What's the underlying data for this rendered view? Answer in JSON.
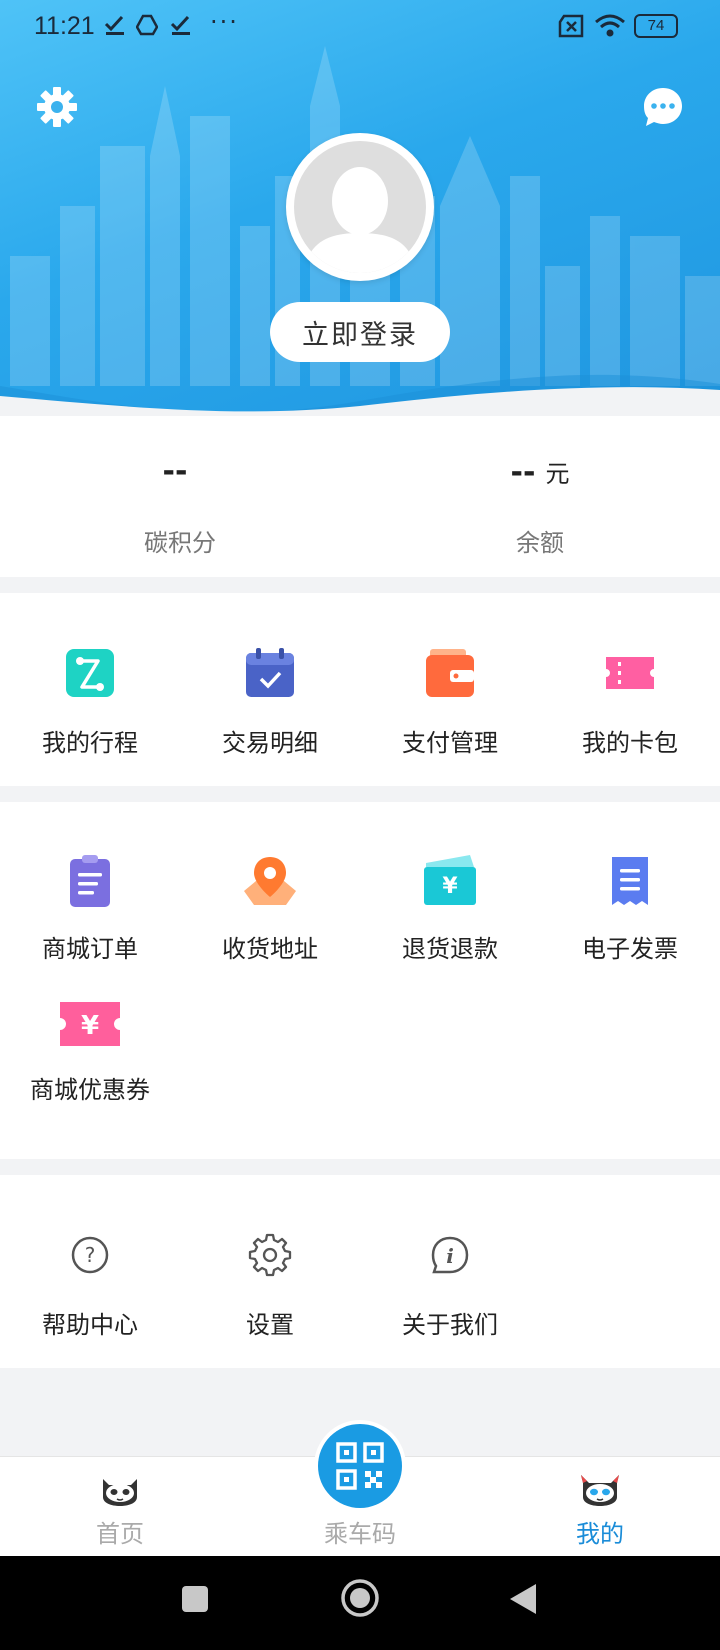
{
  "status_bar": {
    "time": "11:21",
    "overflow": "···",
    "battery": "74"
  },
  "header": {
    "login_label": "立即登录"
  },
  "stats": [
    {
      "value": "--",
      "unit": "",
      "label": "碳积分"
    },
    {
      "value": "--",
      "unit": "元",
      "label": "余额"
    }
  ],
  "section1": [
    {
      "label": "我的行程",
      "icon": "trip-icon",
      "color": "#1ed3c4"
    },
    {
      "label": "交易明细",
      "icon": "calendar-icon",
      "color": "#4a63c7"
    },
    {
      "label": "支付管理",
      "icon": "wallet-icon",
      "color": "#ff6a3d"
    },
    {
      "label": "我的卡包",
      "icon": "card-icon",
      "color": "#ff5fa2"
    }
  ],
  "section2": [
    {
      "label": "商城订单",
      "icon": "order-icon",
      "color": "#7b6fe0"
    },
    {
      "label": "收货地址",
      "icon": "location-icon",
      "color": "#ff8a3d"
    },
    {
      "label": "退货退款",
      "icon": "refund-icon",
      "color": "#1ac8d6"
    },
    {
      "label": "电子发票",
      "icon": "invoice-icon",
      "color": "#5b7cf0"
    },
    {
      "label": "商城优惠券",
      "icon": "coupon-icon",
      "color": "#ff5f9c"
    }
  ],
  "section3": [
    {
      "label": "帮助中心",
      "icon": "help-icon"
    },
    {
      "label": "设置",
      "icon": "settings-icon"
    },
    {
      "label": "关于我们",
      "icon": "info-icon"
    }
  ],
  "bottom_nav": [
    {
      "label": "首页",
      "icon": "home-mascot-icon",
      "active": false
    },
    {
      "label": "乘车码",
      "icon": "qr-code-icon",
      "active": false
    },
    {
      "label": "我的",
      "icon": "profile-mascot-icon",
      "active": true
    }
  ],
  "colors": {
    "accent": "#1a8cd8",
    "header_bg": "#2aa8ec"
  }
}
